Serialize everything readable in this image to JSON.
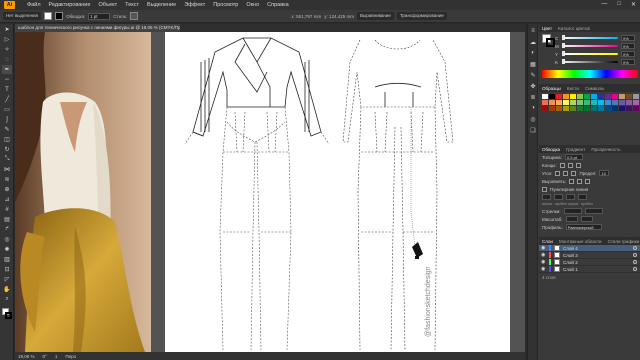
{
  "menubar": {
    "logo": "Ai",
    "items": [
      "Файл",
      "Редактирование",
      "Объект",
      "Текст",
      "Выделение",
      "Эффект",
      "Просмотр",
      "Окно",
      "Справка"
    ],
    "wincontrols": [
      "—",
      "□",
      "✕"
    ]
  },
  "controlbar": {
    "selection_label": "Нет выделения",
    "stroke_label": "Обводка:",
    "stroke_weight": "1 pt",
    "style_label": "Стиль:",
    "x_field": "x: 551,797 mm",
    "y_field": "y: 124,425 mm",
    "align_label": "Выравнивание",
    "transform_label": "Трансформирование"
  },
  "document": {
    "tab_title": "шаблон для технического рисунка с линиями фигуры.ai @ 19,06 % (CMYK/Предварительный просмотр)",
    "watermark": "@fashionsketchdesign"
  },
  "status": {
    "zoom": "19,06 %",
    "angle": "0°",
    "artboard": "1",
    "mode": "Перо"
  },
  "panels": {
    "color_tab": "Цвет",
    "color_guide_tab": "Каталог цветов",
    "sliders": [
      {
        "letter": "C",
        "value": "0%",
        "color": "#00aeef",
        "fraction": 0.0
      },
      {
        "letter": "M",
        "value": "0%",
        "color": "#ec008c",
        "fraction": 0.0
      },
      {
        "letter": "Y",
        "value": "0%",
        "color": "#fff200",
        "fraction": 0.0
      },
      {
        "letter": "K",
        "value": "0%",
        "color": "#000000",
        "fraction": 0.0
      }
    ],
    "swatches_tabs": [
      "Образцы",
      "Кисти",
      "Символы"
    ],
    "swatch_colors": [
      "#ffffff",
      "#000000",
      "#ed1c24",
      "#f7941d",
      "#fff200",
      "#8dc63f",
      "#00a651",
      "#00aeef",
      "#2e3192",
      "#662d91",
      "#ec008c",
      "#c69c6d",
      "#754c24",
      "#999999",
      "#f26c4f",
      "#f68e56",
      "#fbaf5d",
      "#fff568",
      "#acd373",
      "#7cc576",
      "#3cb878",
      "#1cbbb4",
      "#00bff3",
      "#448ccb",
      "#5674b9",
      "#605ca8",
      "#855fa8",
      "#a864a8",
      "#9e0b0f",
      "#a0410d",
      "#a36209",
      "#aba000",
      "#598527",
      "#1a7b30",
      "#007236",
      "#00746b",
      "#0076a3",
      "#004b80",
      "#003471",
      "#1b1464",
      "#440e62",
      "#630460"
    ],
    "stroke_tabs": [
      "Обводка",
      "Градиент",
      "Прозрачность"
    ],
    "stroke_weight_label": "Толщина:",
    "stroke_weight_value": "0,5 pt",
    "cap_label": "Концы:",
    "corner_label": "Угол:",
    "limit_label": "Предел:",
    "limit_value": "10",
    "align_stroke_label": "Выровнять:",
    "dashed_label": "Пунктирная линия",
    "dash_labels": [
      "штрих",
      "пробел",
      "штрих",
      "пробел"
    ],
    "arrow_label": "Стрелки:",
    "scale_label": "Масштаб:",
    "profile_label": "Профиль:",
    "profile_value": "Равномерный",
    "layers_tabs": [
      "Слои",
      "Монтажные области",
      "Стили графики"
    ],
    "layers": [
      {
        "name": "Слой 4",
        "color": "#4f80ff",
        "selected": true
      },
      {
        "name": "Слой 3",
        "color": "#ff4f4f",
        "selected": false
      },
      {
        "name": "Слой 2",
        "color": "#4fff4f",
        "selected": false
      },
      {
        "name": "Слой 1",
        "color": "#4f4fff",
        "selected": false
      }
    ],
    "layers_count": "4 слоя"
  },
  "icons": {
    "tools": [
      "selection-icon",
      "direct-select-icon",
      "magic-wand-icon",
      "lasso-icon",
      "pen-icon",
      "curvature-icon",
      "type-icon",
      "line-icon",
      "rectangle-icon",
      "paintbrush-icon",
      "pencil-icon",
      "eraser-icon",
      "rotate-icon",
      "scale-icon",
      "width-icon",
      "warp-icon",
      "shape-builder-icon",
      "perspective-icon",
      "mesh-icon",
      "gradient-icon",
      "eyedropper-icon",
      "blend-icon",
      "symbol-sprayer-icon",
      "graph-icon",
      "artboard-icon",
      "slice-icon",
      "hand-icon",
      "zoom-icon"
    ]
  }
}
